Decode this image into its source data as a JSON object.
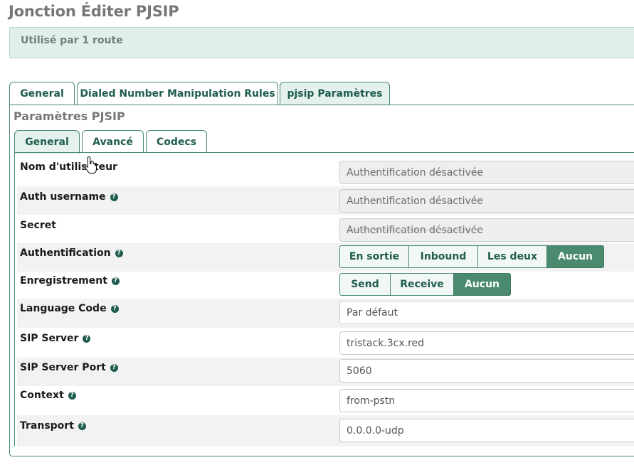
{
  "page": {
    "title": "Jonction Éditer PJSIP"
  },
  "alert": {
    "text": "Utilisé par 1 route"
  },
  "outer_tabs": [
    {
      "label": "General",
      "active": false
    },
    {
      "label": "Dialed Number Manipulation Rules",
      "active": false
    },
    {
      "label": "pjsip Paramètres",
      "active": true
    }
  ],
  "section": {
    "title": "Paramètres PJSIP"
  },
  "inner_tabs": [
    {
      "label": "General",
      "active": true
    },
    {
      "label": "Avancé",
      "active": false
    },
    {
      "label": "Codecs",
      "active": false
    }
  ],
  "fields": {
    "username": {
      "label": "Nom d'utilisateur",
      "value": "Authentification désactivée",
      "disabled": true
    },
    "auth_username": {
      "label": "Auth username",
      "value": "Authentification désactivée",
      "disabled": true
    },
    "secret": {
      "label": "Secret",
      "value": "Authentification désactivée",
      "disabled": true
    },
    "authentication": {
      "label": "Authentification",
      "options": [
        "En sortie",
        "Inbound",
        "Les deux",
        "Aucun"
      ],
      "selected": "Aucun"
    },
    "registration": {
      "label": "Enregistrement",
      "options": [
        "Send",
        "Receive",
        "Aucun"
      ],
      "selected": "Aucun"
    },
    "language_code": {
      "label": "Language Code",
      "value": "Par défaut"
    },
    "sip_server": {
      "label": "SIP Server",
      "value": "tristack.3cx.red"
    },
    "sip_server_port": {
      "label": "SIP Server Port",
      "value": "5060"
    },
    "context": {
      "label": "Context",
      "value": "from-pstn"
    },
    "transport": {
      "label": "Transport",
      "value": "0.0.0.0-udp"
    }
  },
  "icons": {
    "help": "question-circle-icon",
    "cursor": "hand-pointer-icon"
  },
  "colors": {
    "accent": "#4a8a6e",
    "tab_text": "#1f5c4f",
    "alert_bg": "#dff0ec"
  }
}
